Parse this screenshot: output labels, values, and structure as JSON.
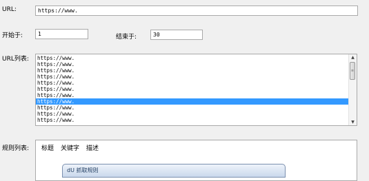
{
  "url": {
    "label": "URL:",
    "value": "https://www."
  },
  "range": {
    "start_label": "开始于:",
    "start_value": "1",
    "end_label": "结束于:",
    "end_value": "30"
  },
  "url_list": {
    "label": "URL列表:",
    "items": [
      "https://www.",
      "https://www.",
      "https://www.",
      "https://www.",
      "https://www.",
      "https://www.",
      "https://www.",
      "https://www.",
      "https://www.",
      "https://www.",
      "https://www."
    ],
    "selected_index": 7
  },
  "rule_list": {
    "label": "规则列表:",
    "columns": [
      "标题",
      "关键字",
      "描述"
    ]
  },
  "dialog": {
    "title": "dU 抓取规则"
  },
  "colors": {
    "selection": "#3399ff",
    "window_bg": "#f0f0f0"
  }
}
